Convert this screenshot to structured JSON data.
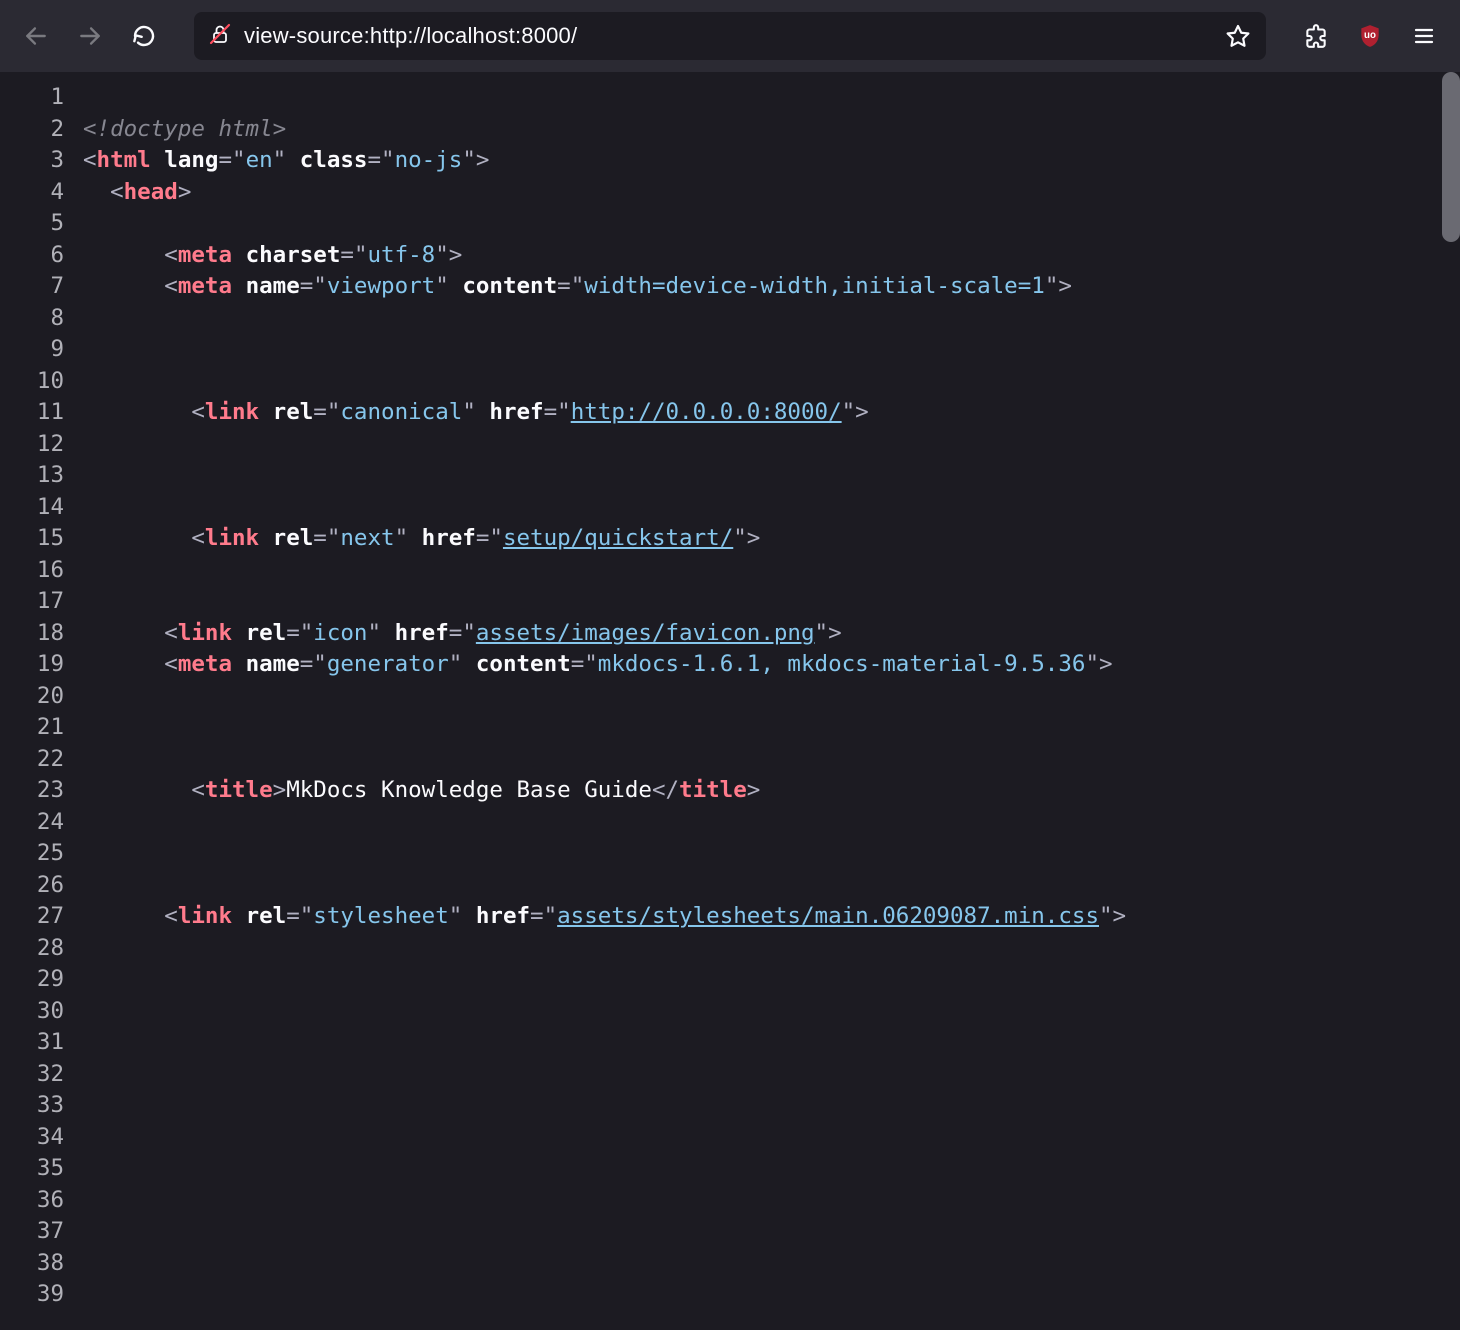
{
  "toolbar": {
    "url": "view-source:http://localhost:8000/"
  },
  "lineCount": 39,
  "source": [
    {
      "type": "blank"
    },
    {
      "type": "doctype",
      "text": "<!doctype html>"
    },
    {
      "type": "openTag",
      "indent": 0,
      "tag": "html",
      "attrs": [
        {
          "name": "lang",
          "value": "en"
        },
        {
          "name": "class",
          "value": "no-js"
        }
      ]
    },
    {
      "type": "openTag",
      "indent": 2,
      "tag": "head",
      "attrs": []
    },
    {
      "type": "blank"
    },
    {
      "type": "voidTag",
      "indent": 6,
      "tag": "meta",
      "attrs": [
        {
          "name": "charset",
          "value": "utf-8"
        }
      ]
    },
    {
      "type": "voidTag",
      "indent": 6,
      "tag": "meta",
      "attrs": [
        {
          "name": "name",
          "value": "viewport"
        },
        {
          "name": "content",
          "value": "width=device-width,initial-scale=1"
        }
      ]
    },
    {
      "type": "blank"
    },
    {
      "type": "blank"
    },
    {
      "type": "blank"
    },
    {
      "type": "voidTag",
      "indent": 8,
      "tag": "link",
      "attrs": [
        {
          "name": "rel",
          "value": "canonical"
        },
        {
          "name": "href",
          "value": "http://0.0.0.0:8000/",
          "link": true
        }
      ]
    },
    {
      "type": "blank"
    },
    {
      "type": "blank"
    },
    {
      "type": "blank"
    },
    {
      "type": "voidTag",
      "indent": 8,
      "tag": "link",
      "attrs": [
        {
          "name": "rel",
          "value": "next"
        },
        {
          "name": "href",
          "value": "setup/quickstart/",
          "link": true
        }
      ]
    },
    {
      "type": "blank"
    },
    {
      "type": "blank"
    },
    {
      "type": "voidTag",
      "indent": 6,
      "tag": "link",
      "attrs": [
        {
          "name": "rel",
          "value": "icon"
        },
        {
          "name": "href",
          "value": "assets/images/favicon.png",
          "link": true
        }
      ]
    },
    {
      "type": "voidTag",
      "indent": 6,
      "tag": "meta",
      "attrs": [
        {
          "name": "name",
          "value": "generator"
        },
        {
          "name": "content",
          "value": "mkdocs-1.6.1, mkdocs-material-9.5.36"
        }
      ]
    },
    {
      "type": "blank"
    },
    {
      "type": "blank"
    },
    {
      "type": "blank"
    },
    {
      "type": "elemText",
      "indent": 8,
      "tag": "title",
      "text": "MkDocs Knowledge Base Guide"
    },
    {
      "type": "blank"
    },
    {
      "type": "blank"
    },
    {
      "type": "blank"
    },
    {
      "type": "voidTag",
      "indent": 6,
      "tag": "link",
      "attrs": [
        {
          "name": "rel",
          "value": "stylesheet"
        },
        {
          "name": "href",
          "value": "assets/stylesheets/main.06209087.min.css",
          "link": true
        }
      ]
    },
    {
      "type": "blank"
    },
    {
      "type": "blank"
    },
    {
      "type": "blank"
    },
    {
      "type": "blank"
    },
    {
      "type": "blank"
    },
    {
      "type": "blank"
    },
    {
      "type": "blank"
    },
    {
      "type": "blank"
    },
    {
      "type": "blank"
    },
    {
      "type": "blank"
    },
    {
      "type": "blank"
    },
    {
      "type": "blank"
    }
  ]
}
